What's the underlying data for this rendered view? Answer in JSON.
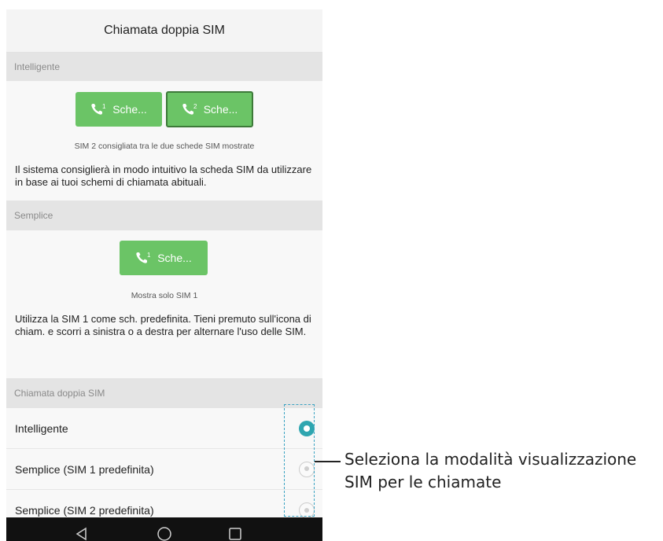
{
  "screen": {
    "title": "Chiamata doppia SIM"
  },
  "intelligent_section": {
    "header": "Intelligente",
    "sim1_label": "Sche...",
    "sim1_number": "1",
    "sim2_label": "Sche...",
    "sim2_number": "2",
    "caption": "SIM 2 consigliata tra le due schede SIM mostrate",
    "description": "Il sistema consiglierà in modo intuitivo la scheda SIM da utilizzare in base ai tuoi schemi di chiamata abituali."
  },
  "simple_section": {
    "header": "Semplice",
    "sim1_label": "Sche...",
    "sim1_number": "1",
    "caption": "Mostra solo SIM 1",
    "description": "Utilizza la SIM 1 come sch. predefinita. Tieni premuto sull'icona di chiam. e scorri a sinistra o a destra per alternare l'uso delle SIM."
  },
  "mode_section": {
    "header": "Chiamata doppia SIM",
    "options": [
      {
        "label": "Intelligente",
        "selected": true
      },
      {
        "label": "Semplice (SIM 1 predefinita)",
        "selected": false
      },
      {
        "label": "Semplice (SIM 2 predefinita)",
        "selected": false
      }
    ]
  },
  "navbar": {
    "icons": [
      "back-icon",
      "home-icon",
      "recents-icon"
    ]
  },
  "annotation": {
    "line1": "Seleziona la modalità visualizzazione",
    "line2": "SIM per le chiamate",
    "color": "#3aa3c2"
  },
  "colors": {
    "sim_button": "#6bc466",
    "radio_selected": "#2fa6b0"
  }
}
